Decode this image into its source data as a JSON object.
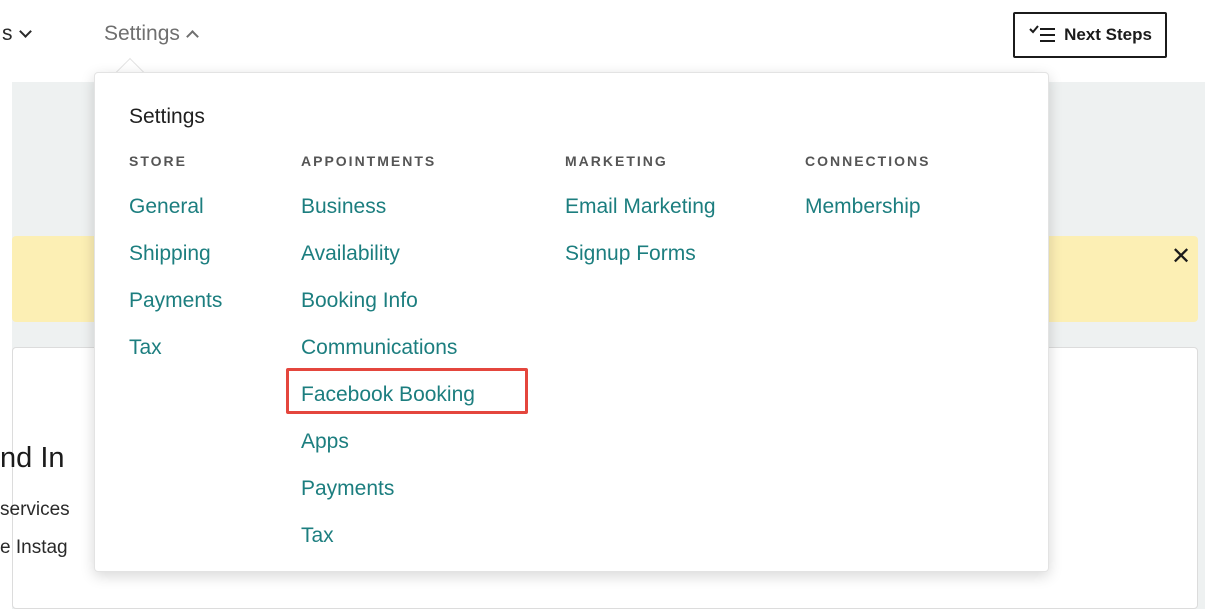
{
  "topbar": {
    "prev_menu_label": "s",
    "settings_label": "Settings",
    "next_steps_label": "Next Steps"
  },
  "background": {
    "banner_close": "✕",
    "card_heading": "nd In",
    "card_text_1": "services",
    "card_text_2": "e Instag"
  },
  "dropdown": {
    "title": "Settings",
    "columns": [
      {
        "header": "STORE",
        "links": [
          "General",
          "Shipping",
          "Payments",
          "Tax"
        ]
      },
      {
        "header": "APPOINTMENTS",
        "links": [
          "Business",
          "Availability",
          "Booking Info",
          "Communications",
          "Facebook Booking",
          "Apps",
          "Payments",
          "Tax"
        ]
      },
      {
        "header": "MARKETING",
        "links": [
          "Email Marketing",
          "Signup Forms"
        ]
      },
      {
        "header": "CONNECTIONS",
        "links": [
          "Membership"
        ]
      }
    ],
    "highlighted_link": "Facebook Booking"
  },
  "colors": {
    "link": "#1c7e7f",
    "banner": "#fcefb4",
    "highlight_border": "#e4463d"
  }
}
